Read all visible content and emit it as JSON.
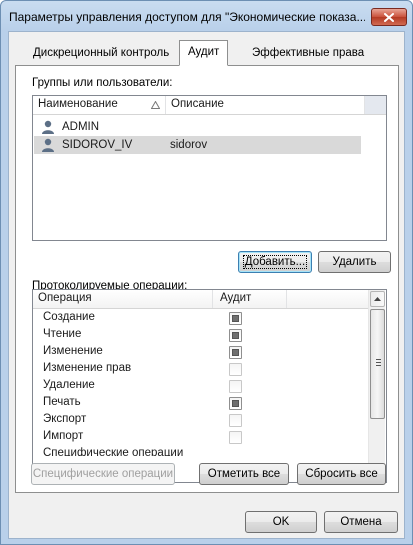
{
  "window": {
    "title": "Параметры управления доступом для \"Экономические показа...",
    "close_icon": "close-icon"
  },
  "tabs": [
    {
      "label": "Дискреционный контроль",
      "active": false
    },
    {
      "label": "Аудит",
      "active": true
    },
    {
      "label": "Эффективные права",
      "active": false
    }
  ],
  "users": {
    "label": "Группы или пользователи:",
    "columns": {
      "name": "Наименование",
      "sort_icon": "sort-ascending-icon",
      "description": "Описание"
    },
    "rows": [
      {
        "name": "ADMIN",
        "description": "",
        "icon": "user-icon",
        "selected": false
      },
      {
        "name": "SIDOROV_IV",
        "description": "sidorov",
        "icon": "user-icon",
        "selected": true
      }
    ]
  },
  "buttons": {
    "add": "Добавить...",
    "remove": "Удалить",
    "specific_ops": "Специфические операции",
    "check_all": "Отметить все",
    "reset_all": "Сбросить все",
    "ok": "OK",
    "cancel": "Отмена"
  },
  "operations": {
    "label": "Протоколируемые операции:",
    "columns": {
      "operation": "Операция",
      "audit": "Аудит"
    },
    "rows": [
      {
        "name": "Создание",
        "audit": true
      },
      {
        "name": "Чтение",
        "audit": true
      },
      {
        "name": "Изменение",
        "audit": true
      },
      {
        "name": "Изменение прав",
        "audit": false
      },
      {
        "name": "Удаление",
        "audit": false
      },
      {
        "name": "Печать",
        "audit": true
      },
      {
        "name": "Экспорт",
        "audit": false
      },
      {
        "name": "Импорт",
        "audit": false
      },
      {
        "name": "Специфические операции",
        "audit": false
      }
    ]
  }
}
